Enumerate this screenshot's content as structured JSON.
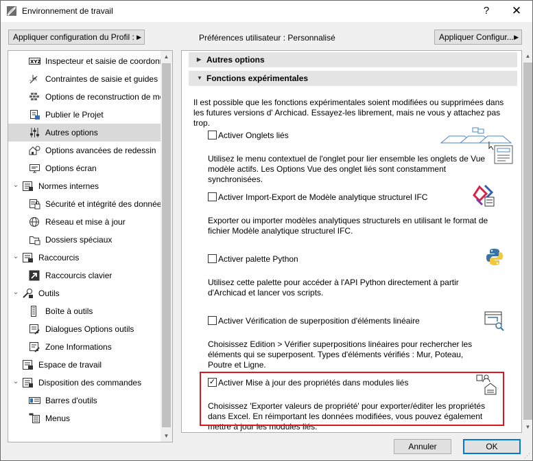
{
  "window": {
    "title": "Environnement de travail",
    "help": "?",
    "close": "✕"
  },
  "toolbar": {
    "profile_button": "Appliquer configuration du Profil :",
    "prefs_label": "Préférences utilisateur :  Personnalisé",
    "apply_config_button": "Appliquer Configur..."
  },
  "tree": [
    {
      "label": "Inspecteur et saisie de coordonn",
      "icon": "xyz-icon"
    },
    {
      "label": "Contraintes de saisie et guides",
      "icon": "guides-icon"
    },
    {
      "label": "Options de reconstruction de mo",
      "icon": "rebuild-icon"
    },
    {
      "label": "Publier le Projet",
      "icon": "publish-icon"
    },
    {
      "label": "Autres options",
      "icon": "sliders-icon"
    },
    {
      "label": "Options avancées de redessin",
      "icon": "redraw-icon"
    },
    {
      "label": "Options écran",
      "icon": "screen-icon"
    },
    {
      "label": "Normes internes",
      "icon": "standards-icon"
    },
    {
      "label": "Sécurité et intégrité des données",
      "icon": "security-icon"
    },
    {
      "label": "Réseau et mise à jour",
      "icon": "globe-icon"
    },
    {
      "label": "Dossiers spéciaux",
      "icon": "folder-icon"
    },
    {
      "label": "Raccourcis",
      "icon": "shortcuts-icon"
    },
    {
      "label": "Raccourcis clavier",
      "icon": "shortcut-arrow-icon"
    },
    {
      "label": "Outils",
      "icon": "tools-icon"
    },
    {
      "label": "Boîte à outils",
      "icon": "toolbox-icon"
    },
    {
      "label": "Dialogues Options outils",
      "icon": "dialog-icon"
    },
    {
      "label": "Zone Informations",
      "icon": "info-box-icon"
    },
    {
      "label": "Espace de travail",
      "icon": "workspace-icon"
    },
    {
      "label": "Disposition des commandes",
      "icon": "commands-icon"
    },
    {
      "label": "Barres d'outils",
      "icon": "toolbars-icon"
    },
    {
      "label": "Menus",
      "icon": "menus-icon"
    }
  ],
  "sections": {
    "other_options": "Autres options",
    "experimental": "Fonctions expérimentales"
  },
  "intro": "Il est possible que les fonctions expérimentales soient modifiées ou supprimées dans les futures versions d' Archicad. Essayez-les librement, mais ne vous y attachez pas trop.",
  "options": [
    {
      "label": "Activer Onglets liés",
      "checked": false,
      "desc": "Utilisez le menu contextuel de l'onglet pour lier ensemble les onglets de Vue modèle actifs. Les Options Vue des onglet liés sont constamment synchronisées."
    },
    {
      "label": "Activer Import-Export de Modèle analytique structurel IFC",
      "checked": false,
      "desc": "Exporter ou importer modèles analytiques structurels en utilisant le format de fichier Modèle analytique structurel IFC."
    },
    {
      "label": "Activer palette Python",
      "checked": false,
      "desc": "Utilisez cette palette pour accéder à l'API Python directement à partir d'Archicad et lancer vos scripts."
    },
    {
      "label": "Activer Vérification de superposition d'éléments linéaire",
      "checked": false,
      "desc": "Choisissez Edition > Vérifier superpositions linéaires pour rechercher les éléments qui se superposent. Types d'éléments vérifiés : Mur, Poteau, Poutre et Ligne."
    },
    {
      "label": "Activer Mise à jour des propriétés dans modules liés",
      "checked": true,
      "desc": "Choisissez 'Exporter valeurs de propriété' pour exporter/éditer les propriétés dans Excel. En réimportant les données modifiées, vous pouvez également mettre à jour les modules liés."
    }
  ],
  "footer": {
    "cancel": "Annuler",
    "ok": "OK"
  },
  "colors": {
    "highlight": "#e0141e",
    "selection": "#d9d9d9"
  }
}
